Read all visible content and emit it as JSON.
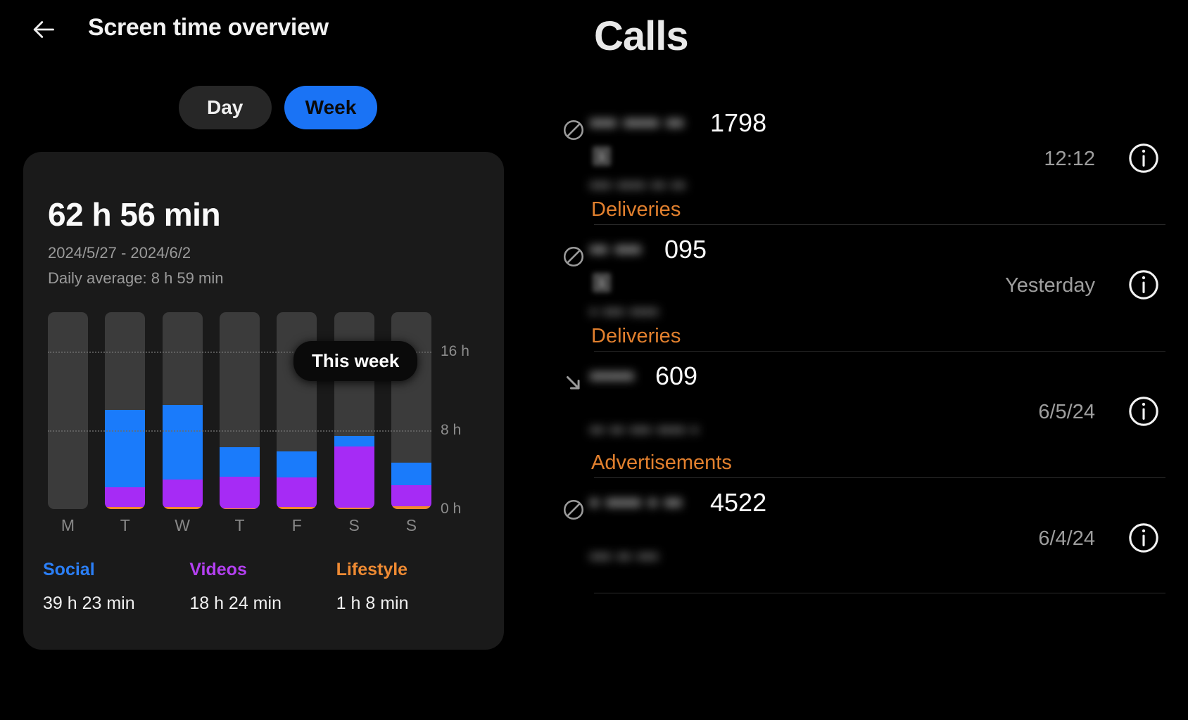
{
  "header": {
    "back_icon": "arrow-left-icon",
    "title": "Screen time overview"
  },
  "segmented": {
    "day_label": "Day",
    "week_label": "Week",
    "selected": "Week"
  },
  "summary": {
    "total": "62 h 56 min",
    "date_range": "2024/5/27 - 2024/6/2",
    "daily_average": "Daily average: 8 h 59 min"
  },
  "chart_data": {
    "type": "bar",
    "title": "Screen time this week",
    "stacked": true,
    "categories": [
      "M",
      "T",
      "W",
      "T",
      "F",
      "S",
      "S"
    ],
    "series": [
      {
        "name": "Social",
        "color": "#1a7bfb",
        "values": [
          0,
          7.9,
          7.6,
          3.0,
          2.6,
          1.1,
          2.3
        ]
      },
      {
        "name": "Videos",
        "color": "#a62bf5",
        "values": [
          0,
          2.0,
          2.8,
          3.2,
          3.0,
          6.2,
          2.1
        ]
      },
      {
        "name": "Lifestyle",
        "color": "#f08a2c",
        "values": [
          0,
          0.2,
          0.2,
          0.1,
          0.25,
          0.15,
          0.3
        ]
      }
    ],
    "yticks": [
      "16 h",
      "8 h",
      "0 h"
    ],
    "ytick_values": [
      16,
      8,
      0
    ],
    "ylim": [
      0,
      20
    ],
    "ylabel": "",
    "xlabel": "",
    "grid": true,
    "annotation": "This week",
    "legend_position": "bottom"
  },
  "legend": [
    {
      "name": "Social",
      "value": "39 h 23 min",
      "color": "#2b7ff7"
    },
    {
      "name": "Videos",
      "value": "18 h 24 min",
      "color": "#b340f0"
    },
    {
      "name": "Lifestyle",
      "value": "1 h 8 min",
      "color": "#ee8a33"
    }
  ],
  "calls": {
    "title": "Calls",
    "rows": [
      {
        "status_icon": "blocked-icon",
        "name_redacted": "••• •••• ••",
        "number_tail": "1798",
        "sim_badge": "1",
        "sub_redacted": "•••  ••••  •• ••",
        "tag": "Deliveries",
        "time": "12:12",
        "info_icon": "info-icon"
      },
      {
        "status_icon": "blocked-icon",
        "name_redacted": "•• •••",
        "number_tail": "095",
        "sim_badge": "1",
        "sub_redacted": "• ••• ••••",
        "tag": "Deliveries",
        "time": "Yesterday",
        "info_icon": "info-icon"
      },
      {
        "status_icon": "incoming-call-icon",
        "name_redacted": "•••••",
        "number_tail": "609",
        "sim_badge": "",
        "sub_redacted": "•• •• ••• •••• •",
        "tag": "Advertisements",
        "time": "6/5/24",
        "info_icon": "info-icon"
      },
      {
        "status_icon": "blocked-icon",
        "name_redacted": "• •••• • ••",
        "number_tail": "4522",
        "sim_badge": "",
        "sub_redacted": "••• •• •••",
        "tag": "",
        "time": "6/4/24",
        "info_icon": "info-icon"
      }
    ]
  },
  "colors": {
    "accent_blue": "#1a73f5",
    "social": "#1a7bfb",
    "videos": "#a62bf5",
    "lifestyle": "#f08a2c",
    "tag_orange": "#e2802e",
    "card_bg": "#1a1a1a",
    "bar_track": "#3b3b3b"
  }
}
